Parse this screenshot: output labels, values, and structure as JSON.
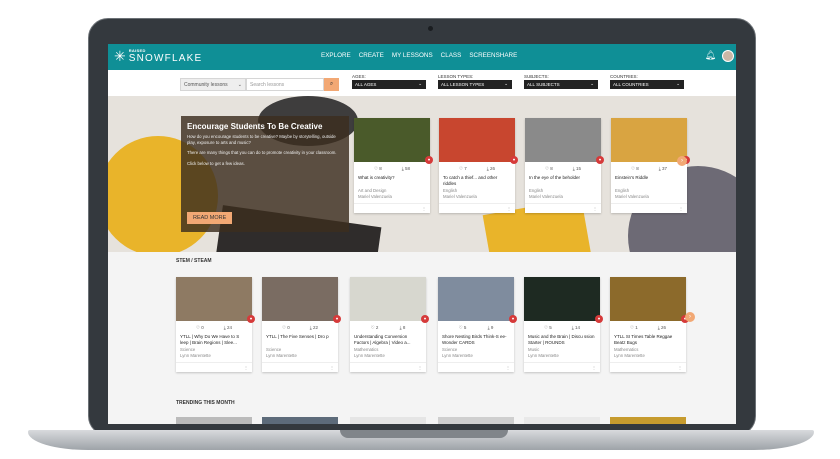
{
  "nav": {
    "logo_small": "RAISED",
    "logo_big": "SNOWFLAKE",
    "items": [
      "EXPLORE",
      "CREATE",
      "MY LESSONS",
      "CLASS",
      "SCREENSHARE"
    ]
  },
  "filters": {
    "select_value": "Community lessons",
    "search_placeholder": "Search lessons",
    "groups": [
      {
        "label": "AGES:",
        "value": "ALL AGES"
      },
      {
        "label": "LESSON TYPES:",
        "value": "ALL LESSON TYPES"
      },
      {
        "label": "SUBJECTS:",
        "value": "ALL SUBJECTS"
      },
      {
        "label": "COUNTRIES:",
        "value": "ALL COUNTRIES"
      }
    ]
  },
  "hero": {
    "title": "Encourage Students To Be Creative",
    "p1": "How do you encourage students to be creative? Maybe by storytelling, outside play, exposure to arts and music?",
    "p2": "There are many things that you can do to promote creativity in your classroom.",
    "p3": "Click below to get a few ideas.",
    "button": "READ MORE"
  },
  "featured": [
    {
      "likes": "8",
      "downloads": "58",
      "title": "What is creativity?",
      "subject": "Art and Design",
      "author": "Mariel Valenzuela",
      "color": "#4a5a2a"
    },
    {
      "likes": "7",
      "downloads": "26",
      "title": "To catch a thief... and other riddles",
      "subject": "English",
      "author": "Mariel Valenzuela",
      "color": "#c8462f"
    },
    {
      "likes": "8",
      "downloads": "15",
      "title": "In the eye of the beholder",
      "subject": "English",
      "author": "Mariel Valenzuela",
      "color": "#8a8a8a"
    },
    {
      "likes": "8",
      "downloads": "37",
      "title": "Einstein's Riddle",
      "subject": "English",
      "author": "Mariel Valenzuela",
      "color": "#d9a441"
    }
  ],
  "stem_title": "STEM / STEAM",
  "stem": [
    {
      "likes": "0",
      "downloads": "24",
      "title": "YTLL | Why Do We Have to S leep | Brain Regions | Slee...",
      "subject": "Science",
      "author": "Lynn Marentette",
      "color": "#8e7a63"
    },
    {
      "likes": "0",
      "downloads": "22",
      "title": "YTLL | The Five Senses | Dro p",
      "subject": "Science",
      "author": "Lynn Marentette",
      "color": "#7a6c62"
    },
    {
      "likes": "2",
      "downloads": "8",
      "title": "Understanding Conversion Factors | Algebra | Video a...",
      "subject": "Mathematics",
      "author": "Lynn Marentette",
      "color": "#d7d7cf"
    },
    {
      "likes": "5",
      "downloads": "9",
      "title": "Shore Nesting Birds Think-S ee-Wonder CARDS",
      "subject": "Science",
      "author": "Lynn Marentette",
      "color": "#7f8c9e"
    },
    {
      "likes": "5",
      "downloads": "14",
      "title": "Music and the Brain | Discu ssion Starter | ROUNDS",
      "subject": "Music",
      "author": "Lynn Marentette",
      "color": "#1e2a22"
    },
    {
      "likes": "1",
      "downloads": "26",
      "title": "YTLL SI Times Table Reggae Beatz Bugs",
      "subject": "Mathematics",
      "author": "Lynn Marentette",
      "color": "#8c6a2b"
    }
  ],
  "trending_title": "TRENDING THIS MONTH",
  "icons": {
    "logo": "snowflake-icon",
    "bell": "bell-icon",
    "search": "search-icon",
    "heart": "heart-icon",
    "download": "download-icon",
    "next": "chevron-right-icon",
    "caret": "chevron-down-icon"
  }
}
